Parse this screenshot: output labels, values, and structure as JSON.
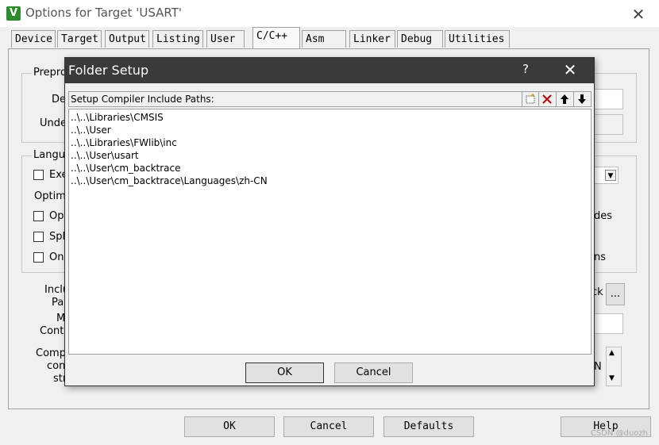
{
  "window": {
    "title": "Options for Target 'USART'",
    "close_glyph": "✕",
    "app_icon_glyph": "V"
  },
  "tabs": [
    "Device",
    "Target",
    "Output",
    "Listing",
    "User",
    "C/C++",
    "Asm",
    "Linker",
    "Debug",
    "Utilities"
  ],
  "active_tab": "C/C++",
  "background": {
    "preprocessor_label": "Prepro",
    "define_label": "De",
    "undefine_label": "Unde",
    "language_label": "Langua",
    "execute_label": "Exe",
    "optimization_label": "Optimi",
    "opt_label": "Opt",
    "split_label": "Spl",
    "one_label": "One",
    "include_label": "Inclu",
    "paths_label": "Pa",
    "misc_label": "M",
    "controls_label": "Contr",
    "compiler_label": "Comp",
    "control_label": "con",
    "string_label": "str",
    "right_text_1": "des",
    "right_text_2": "ns",
    "browse_partial": "ck",
    "ellipsis": "...",
    "scroll_letter": "N",
    "dropdown_arrow": "▼",
    "scroll_up": "▲",
    "scroll_down": "▼"
  },
  "dialog": {
    "title": "Folder Setup",
    "help_glyph": "?",
    "close_glyph": "✕",
    "list_header": "Setup Compiler Include Paths:",
    "toolbar": {
      "new_icon": "new-folder-icon",
      "delete_icon": "delete-icon",
      "up_icon": "move-up-icon",
      "down_icon": "move-down-icon",
      "delete_glyph": "✕",
      "up_glyph": "🡅",
      "down_glyph": "🡇",
      "delete_color": "#c00000"
    },
    "paths": [
      "..\\..\\Libraries\\CMSIS",
      "..\\..\\User",
      "..\\..\\Libraries\\FWlib\\inc",
      "..\\..\\User\\usart",
      "..\\..\\User\\cm_backtrace",
      "..\\..\\User\\cm_backtrace\\Languages\\zh-CN"
    ],
    "ok_label": "OK",
    "cancel_label": "Cancel"
  },
  "footer": {
    "ok_label": "OK",
    "cancel_label": "Cancel",
    "defaults_label": "Defaults",
    "help_label": "Help"
  },
  "watermark": "CSDN @duozh"
}
